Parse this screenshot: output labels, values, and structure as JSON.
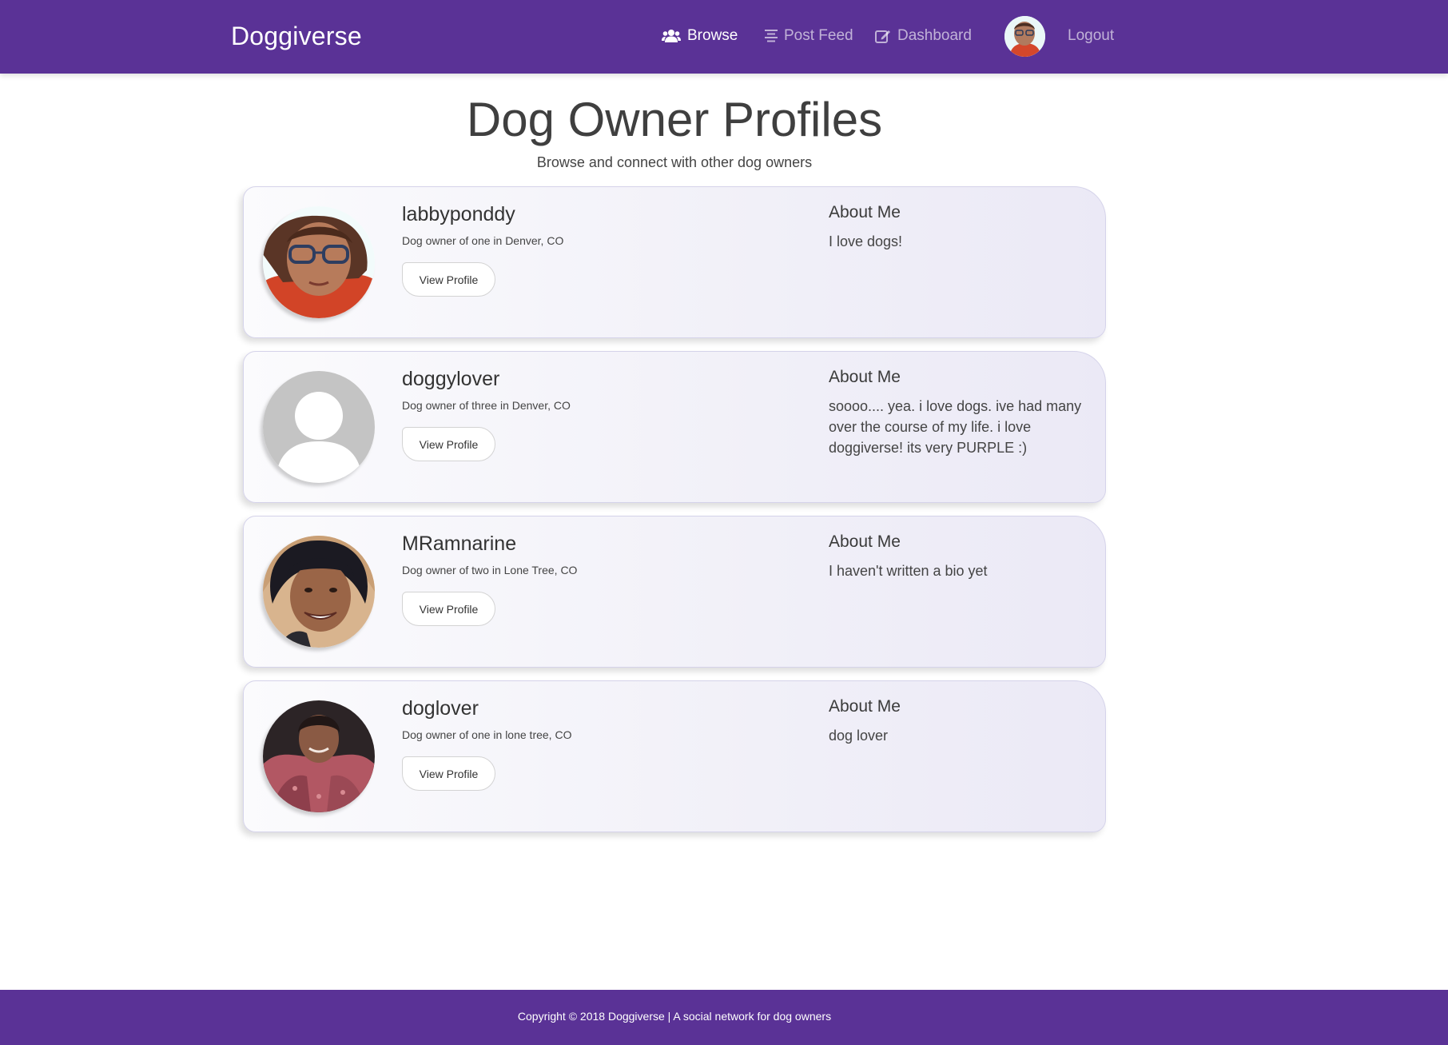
{
  "nav": {
    "brand": "Doggiverse",
    "items": [
      {
        "label": "Browse",
        "icon": "users-icon",
        "active": true
      },
      {
        "label": "Post Feed",
        "icon": "align-center-icon",
        "active": false
      },
      {
        "label": "Dashboard",
        "icon": "edit-icon",
        "active": false
      }
    ],
    "logout": "Logout"
  },
  "header": {
    "title": "Dog Owner Profiles",
    "subtitle": "Browse and connect with other dog owners"
  },
  "profiles": [
    {
      "username": "labbyponddy",
      "description": "Dog owner of one in Denver, CO",
      "button": "View Profile",
      "about_title": "About Me",
      "about": "I love dogs!",
      "avatar": "photo-avatar-glasses"
    },
    {
      "username": "doggylover",
      "description": "Dog owner of three in Denver, CO",
      "button": "View Profile",
      "about_title": "About Me",
      "about": "soooo.... yea. i love dogs. ive had many over the course of my life. i love doggiverse! its very PURPLE :)",
      "avatar": "default-user-avatar"
    },
    {
      "username": "MRamnarine",
      "description": "Dog owner of two in Lone Tree, CO",
      "button": "View Profile",
      "about_title": "About Me",
      "about": "I haven't written a bio yet",
      "avatar": "photo-avatar-curly-hair"
    },
    {
      "username": "doglover",
      "description": "Dog owner of one in lone tree, CO",
      "button": "View Profile",
      "about_title": "About Me",
      "about": "dog lover",
      "avatar": "photo-avatar-scarf"
    }
  ],
  "footer": {
    "text": "Copyright © 2018 Doggiverse | A social network for dog owners"
  },
  "colors": {
    "brand_purple": "#5a3296",
    "card_border": "#d5d3ea"
  }
}
